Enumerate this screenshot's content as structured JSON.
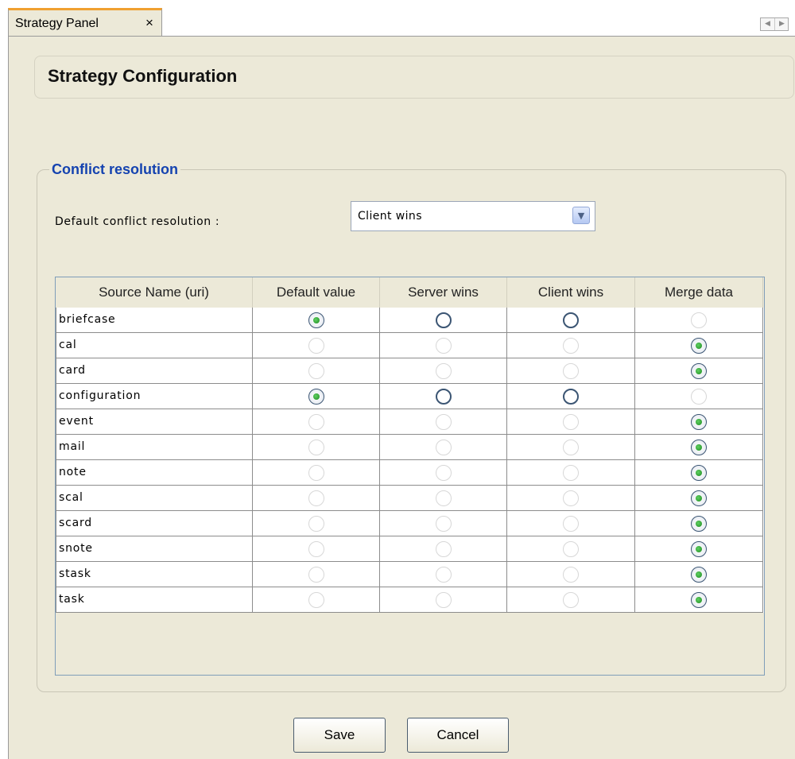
{
  "tab": {
    "label": "Strategy Panel",
    "close": "×"
  },
  "page": {
    "title": "Strategy Configuration",
    "section_title": "Conflict resolution",
    "default_label": "Default conflict resolution :",
    "default_value": "Client wins"
  },
  "table": {
    "columns": [
      "Source Name (uri)",
      "Default value",
      "Server wins",
      "Client wins",
      "Merge data"
    ],
    "rows": [
      {
        "name": "briefcase",
        "selected": "Default value",
        "enabled": [
          "Default value",
          "Server wins",
          "Client wins"
        ]
      },
      {
        "name": "cal",
        "selected": "Merge data",
        "enabled": [
          "Merge data"
        ]
      },
      {
        "name": "card",
        "selected": "Merge data",
        "enabled": [
          "Merge data"
        ]
      },
      {
        "name": "configuration",
        "selected": "Default value",
        "enabled": [
          "Default value",
          "Server wins",
          "Client wins"
        ]
      },
      {
        "name": "event",
        "selected": "Merge data",
        "enabled": [
          "Merge data"
        ]
      },
      {
        "name": "mail",
        "selected": "Merge data",
        "enabled": [
          "Merge data"
        ]
      },
      {
        "name": "note",
        "selected": "Merge data",
        "enabled": [
          "Merge data"
        ]
      },
      {
        "name": "scal",
        "selected": "Merge data",
        "enabled": [
          "Merge data"
        ]
      },
      {
        "name": "scard",
        "selected": "Merge data",
        "enabled": [
          "Merge data"
        ]
      },
      {
        "name": "snote",
        "selected": "Merge data",
        "enabled": [
          "Merge data"
        ]
      },
      {
        "name": "stask",
        "selected": "Merge data",
        "enabled": [
          "Merge data"
        ]
      },
      {
        "name": "task",
        "selected": "Merge data",
        "enabled": [
          "Merge data"
        ]
      }
    ]
  },
  "buttons": {
    "save": "Save",
    "cancel": "Cancel"
  },
  "icons": {
    "tab_close": "close-icon",
    "nav_left": "arrow-left-icon",
    "nav_right": "arrow-right-icon",
    "dropdown": "chevron-down-icon"
  },
  "colors": {
    "panel_bg": "#ece9d8",
    "section_title": "#1543b0",
    "active_tab_accent": "#f0a030",
    "radio_dot": "#1d8a21"
  }
}
